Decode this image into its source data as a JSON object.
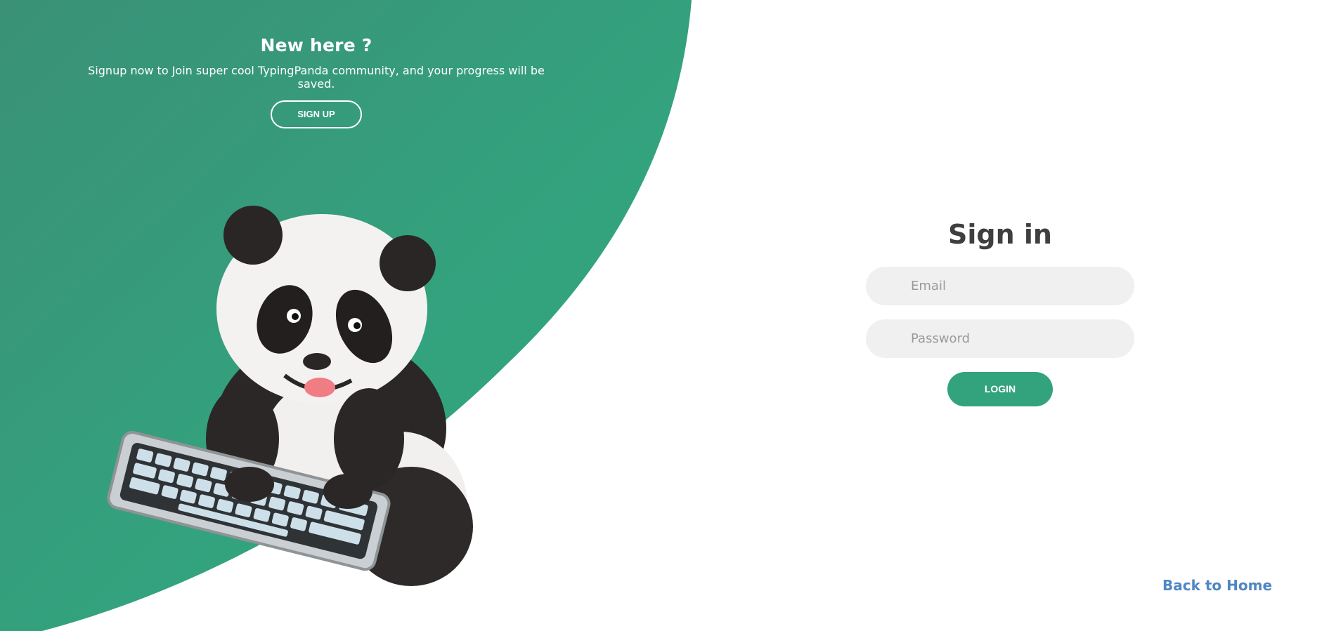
{
  "colors": {
    "accent_green": "#33a37e",
    "link_blue": "#4f87c2",
    "title_dark": "#3f3f3f"
  },
  "left_panel": {
    "title": "New here ?",
    "description": "Signup now to Join super cool TypingPanda community, and your progress will be saved.",
    "signup_label": "SIGN UP",
    "illustration": "panda-typing-on-keyboard"
  },
  "signin": {
    "title": "Sign in",
    "email_placeholder": "Email",
    "password_placeholder": "Password",
    "login_label": "LOGIN"
  },
  "footer": {
    "back_home_label": "Back to Home"
  }
}
